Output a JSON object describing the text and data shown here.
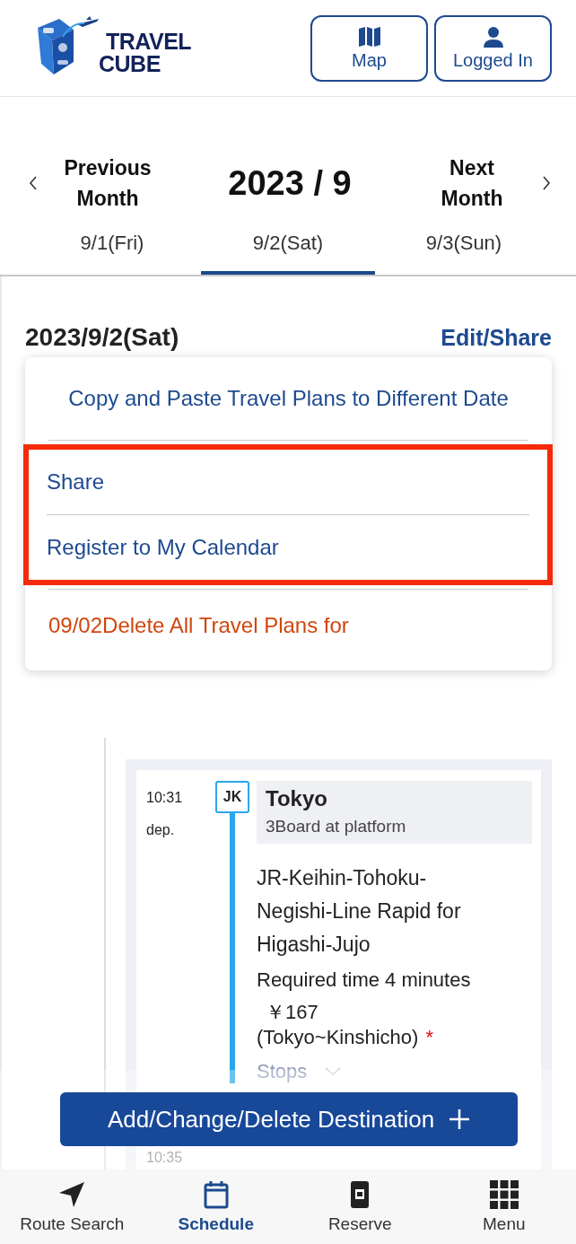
{
  "header": {
    "logo_lines": [
      "TRAVEL",
      "CUBE"
    ],
    "buttons": [
      {
        "label": "Map"
      },
      {
        "label": "Logged In"
      }
    ]
  },
  "month_nav": {
    "previous": "Previous Month",
    "title": "2023 / 9",
    "next": "Next Month"
  },
  "days": [
    {
      "label": "9/1(Fri)",
      "selected": false
    },
    {
      "label": "9/2(Sat)",
      "selected": true
    },
    {
      "label": "9/3(Sun)",
      "selected": false
    }
  ],
  "day_heading": {
    "date": "2023/9/2(Sat)",
    "action": "Edit/Share"
  },
  "menu": {
    "items": [
      {
        "label": "Copy and Paste Travel Plans to Different Date",
        "kind": "centered",
        "highlighted": false
      },
      {
        "label": "Share",
        "kind": "normal",
        "highlighted": true
      },
      {
        "label": "Register to My Calendar",
        "kind": "normal",
        "highlighted": true
      },
      {
        "label": "09/02Delete All Travel Plans for",
        "kind": "danger",
        "highlighted": false
      }
    ]
  },
  "itinerary": {
    "time": "10:31",
    "status": "dep.",
    "line_badge": "JK",
    "station": "Tokyo",
    "platform": "3Board at platform",
    "route": "JR-Keihin-Tohoku-Negishi-Line Rapid for Higashi-Jujo",
    "duration": "Required time 4 minutes",
    "fare": "￥167",
    "fare_section": "(Tokyo~Kinshicho)",
    "fare_note": "*",
    "stops_label": "Stops",
    "next_time": "10:35"
  },
  "action_button": {
    "label": "Add/Change/Delete Destination"
  },
  "bottom_nav": [
    {
      "label": "Route Search",
      "selected": false
    },
    {
      "label": "Schedule",
      "selected": true
    },
    {
      "label": "Reserve",
      "selected": false
    },
    {
      "label": "Menu",
      "selected": false
    }
  ]
}
